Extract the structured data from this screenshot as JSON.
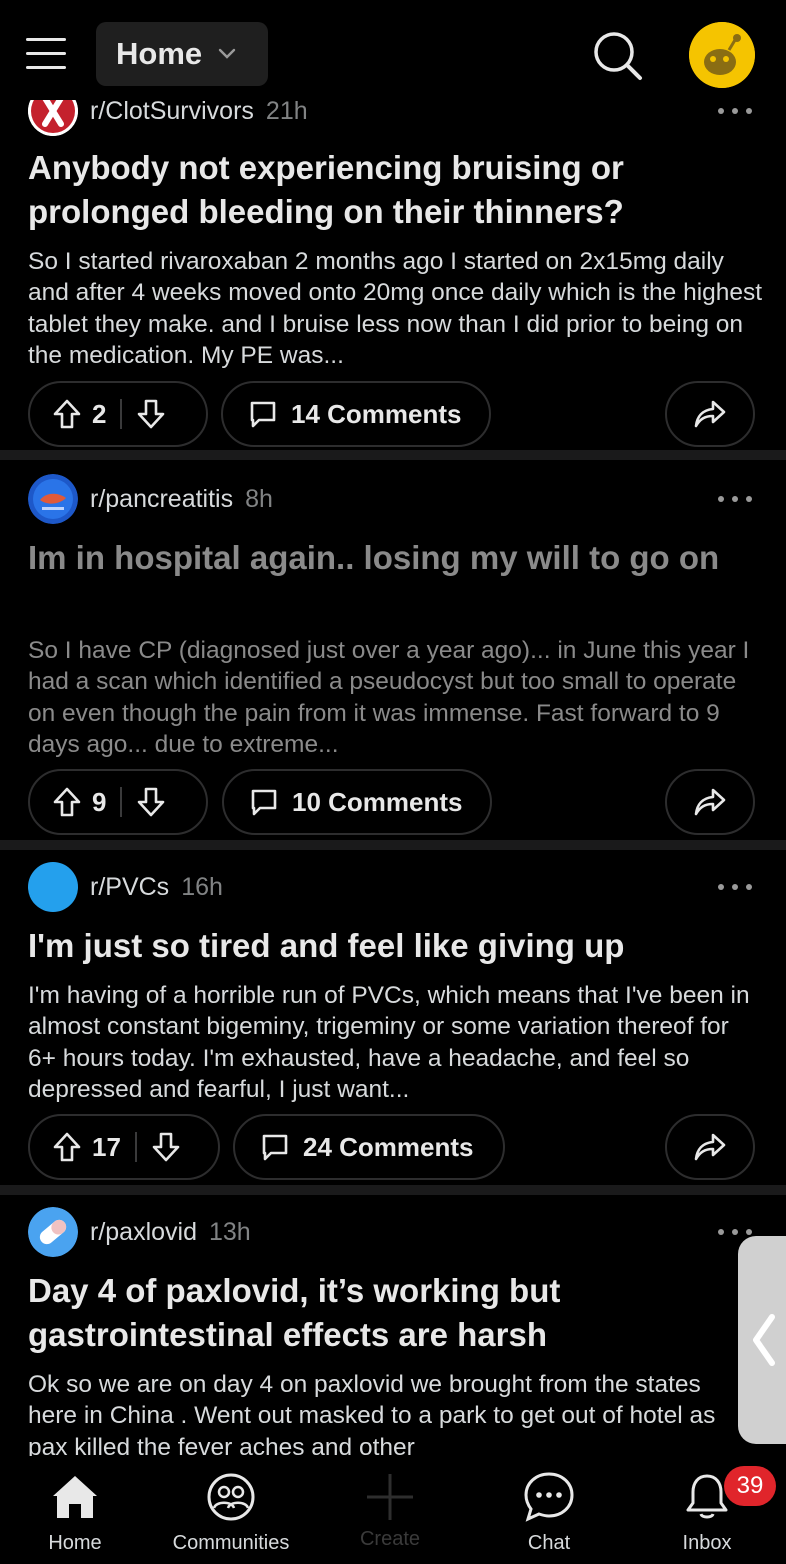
{
  "header": {
    "feed_label": "Home"
  },
  "colors": {
    "background": "#000000",
    "avatar": "#f5c400",
    "badge": "#e0252b"
  },
  "posts": [
    {
      "subreddit": "r/ClotSurvivors",
      "time": "21h",
      "title": "Anybody not experiencing bruising or prolonged bleeding on their thinners?",
      "body": "So I started rivaroxaban 2 months ago I started on 2x15mg daily and after 4 weeks moved onto 20mg once daily which is the highest tablet they make. and I bruise less now than I did prior to being on the medication. My PE was...",
      "votes": "2",
      "comments": "14 Comments",
      "read": false
    },
    {
      "subreddit": "r/pancreatitis",
      "time": "8h",
      "title": "Im in hospital again.. losing my will to go on",
      "body": "So I have CP (diagnosed just over a year ago)... in June this year I had a scan which identified a pseudocyst but too small to operate on even though the pain from it was immense. Fast forward to 9 days ago... due to extreme...",
      "votes": "9",
      "comments": "10 Comments",
      "read": true
    },
    {
      "subreddit": "r/PVCs",
      "time": "16h",
      "title": "I'm just so tired and feel like giving up",
      "body": "I'm having of a horrible run of PVCs, which means that I've been in almost constant bigeminy, trigeminy or some variation thereof for 6+ hours today. I'm exhausted, have a headache, and feel so depressed and fearful, I just want...",
      "votes": "17",
      "comments": "24 Comments",
      "read": false
    },
    {
      "subreddit": "r/paxlovid",
      "time": "13h",
      "title": "Day 4 of paxlovid, it’s working but gastrointestinal effects are harsh",
      "body": "Ok so we are on day 4 on paxlovid we brought from the states here in China .  Went out masked to a park to get out of hotel as pax killed the fever aches and other",
      "read": false
    }
  ],
  "tabs": {
    "home": "Home",
    "communities": "Communities",
    "create": "Create",
    "chat": "Chat",
    "inbox": "Inbox",
    "inbox_badge": "39"
  }
}
